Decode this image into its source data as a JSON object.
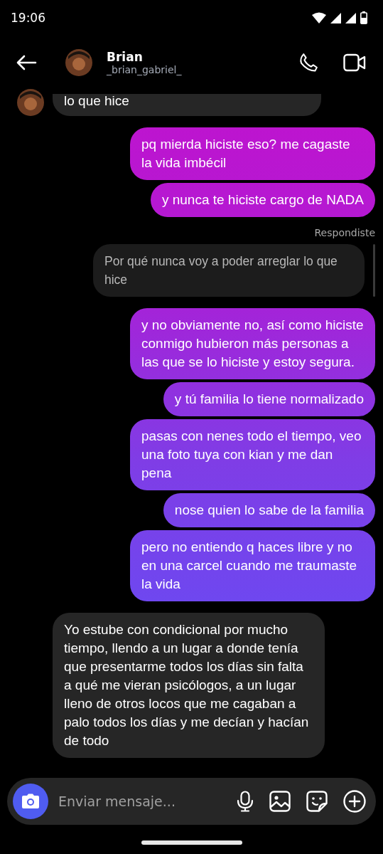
{
  "status_bar": {
    "time": "19:06"
  },
  "header": {
    "name": "Brian",
    "username": "_brian_gabriel_"
  },
  "messages": [
    {
      "kind": "received",
      "text": "lo que hice",
      "avatar": true
    },
    {
      "kind": "sent",
      "text": "pq mierda hiciste eso? me cagaste la vida imbécil"
    },
    {
      "kind": "sent",
      "text": "y nunca te hiciste cargo de NADA"
    },
    {
      "kind": "reply",
      "label": "Respondiste",
      "text": "Por qué nunca voy a poder arreglar lo que hice"
    },
    {
      "kind": "sent",
      "text": "y no obviamente no, así como hiciste conmigo hubieron más personas a las que se lo hiciste y estoy segura."
    },
    {
      "kind": "sent",
      "text": "y tú familia lo tiene normalizado"
    },
    {
      "kind": "sent",
      "text": "pasas con nenes todo el tiempo, veo una foto tuya con kian y me dan pena"
    },
    {
      "kind": "sent",
      "text": "nose quien lo sabe de la familia"
    },
    {
      "kind": "sent",
      "text": "pero no entiendo q haces libre y no en una carcel cuando me traumaste la vida"
    },
    {
      "kind": "received",
      "text": "Yo estube con condicional por mucho tiempo, llendo a un lugar a donde tenía que presentarme todos los días sin falta a qué me vieran psicólogos, a un lugar lleno de otros locos que me cagaban a palo todos los días y me decían y hacían de todo",
      "avatar": false
    }
  ],
  "composer": {
    "placeholder": "Enviar mensaje..."
  }
}
